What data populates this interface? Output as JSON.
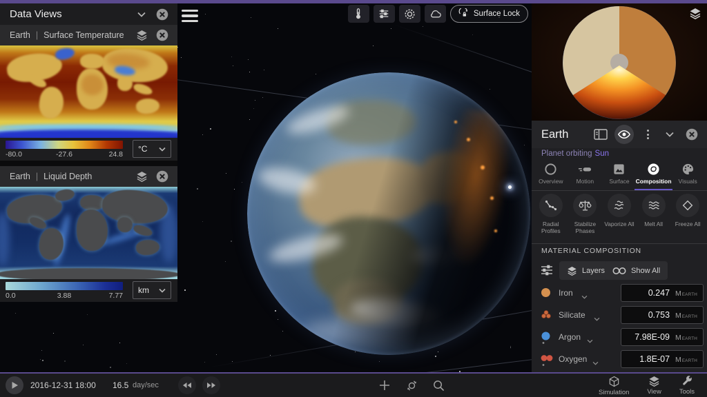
{
  "colors": {
    "accent_purple": "#5a4a8d",
    "link_purple": "#8a74ee",
    "tab_underline": "#6657c8"
  },
  "data_views_panel": {
    "title": "Data Views",
    "views": [
      {
        "object": "Earth",
        "separator": "|",
        "name": "Surface Temperature",
        "scale_min": "-80.0",
        "scale_mid": "-27.6",
        "scale_max": "24.8",
        "unit": "°C"
      },
      {
        "object": "Earth",
        "separator": "|",
        "name": "Liquid Depth",
        "scale_min": "0.0",
        "scale_mid": "3.88",
        "scale_max": "7.77",
        "unit": "km"
      }
    ]
  },
  "viewport": {
    "surface_lock_label": "Surface Lock"
  },
  "object_panel": {
    "title": "Earth",
    "subtitle_prefix": "Planet orbiting",
    "subtitle_link": "Sun",
    "tabs": [
      {
        "label": "Overview"
      },
      {
        "label": "Motion"
      },
      {
        "label": "Surface"
      },
      {
        "label": "Composition"
      },
      {
        "label": "Visuals"
      }
    ],
    "actions": [
      {
        "label": "Radial Profiles"
      },
      {
        "label": "Stabilize Phases"
      },
      {
        "label": "Vaporize All"
      },
      {
        "label": "Melt All"
      },
      {
        "label": "Freeze All"
      }
    ],
    "section_title": "MATERIAL COMPOSITION",
    "layers_button": "Layers",
    "show_all_button": "Show All",
    "materials": [
      {
        "name": "Iron",
        "value": "0.247",
        "unit": "M",
        "unit_sub": "EARTH",
        "color": "#d4904f"
      },
      {
        "name": "Silicate",
        "value": "0.753",
        "unit": "M",
        "unit_sub": "EARTH",
        "color": "#c96a3e"
      },
      {
        "name": "Argon",
        "value": "7.98E-09",
        "unit": "M",
        "unit_sub": "EARTH",
        "color": "#4a90d9"
      },
      {
        "name": "Oxygen",
        "value": "1.8E-07",
        "unit": "M",
        "unit_sub": "EARTH",
        "color": "#d05543"
      }
    ]
  },
  "time_bar": {
    "datetime": "2016-12-31 18:00",
    "speed_value": "16.5",
    "speed_unit": "day/sec"
  },
  "bottom_menus": [
    {
      "label": "Simulation"
    },
    {
      "label": "View"
    },
    {
      "label": "Tools"
    }
  ]
}
